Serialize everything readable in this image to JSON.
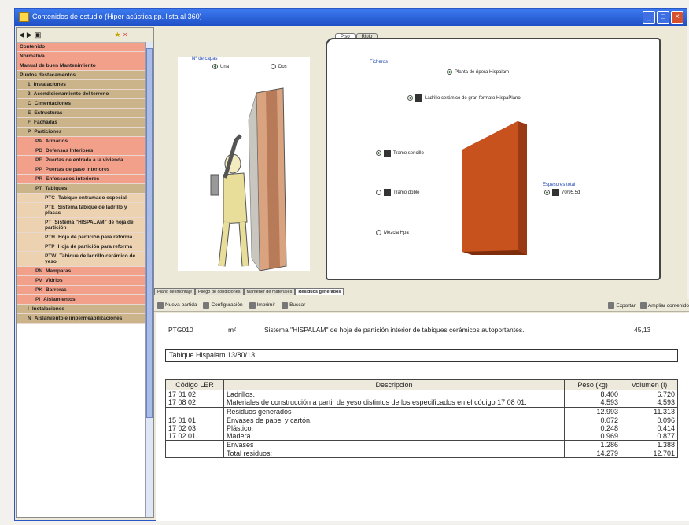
{
  "window": {
    "title": "Contenidos de estudio (Hiper acústica pp. lista al 360)",
    "buttons": [
      "_",
      "□",
      "×"
    ]
  },
  "sidebar": {
    "toolbar_icons": [
      "back-icon",
      "forward-icon",
      "car-icon",
      "star-icon",
      "close-icon"
    ],
    "items": [
      {
        "label": "Contenido",
        "color": "pink",
        "indent": 0
      },
      {
        "label": "Normativa",
        "color": "pink",
        "indent": 0
      },
      {
        "label": "Manual de buen Mantenimiento",
        "color": "pink",
        "indent": 0
      },
      {
        "label": "Puntos destacamentos",
        "color": "tan",
        "indent": 0
      },
      {
        "code": "1",
        "label": "Instalaciones",
        "color": "tan",
        "indent": 1
      },
      {
        "code": "2",
        "label": "Acondicionamiento del terreno",
        "color": "tan",
        "indent": 1
      },
      {
        "code": "C",
        "label": "Cimentaciones",
        "color": "tan",
        "indent": 1
      },
      {
        "code": "E",
        "label": "Estructuras",
        "color": "tan",
        "indent": 1
      },
      {
        "code": "F",
        "label": "Fachadas",
        "color": "tan",
        "indent": 1
      },
      {
        "code": "P",
        "label": "Particiones",
        "color": "tan",
        "indent": 1
      },
      {
        "code": "PA",
        "label": "Armarios",
        "color": "pink",
        "indent": 2
      },
      {
        "code": "PD",
        "label": "Defensas Interiores",
        "color": "pink",
        "indent": 2
      },
      {
        "code": "PE",
        "label": "Puertas de entrada a la vivienda",
        "color": "pink",
        "indent": 2
      },
      {
        "code": "PP",
        "label": "Puertas de paso interiores",
        "color": "pink",
        "indent": 2
      },
      {
        "code": "PR",
        "label": "Enfoscados interiores",
        "color": "pink",
        "indent": 2
      },
      {
        "code": "PT",
        "label": "Tabiques",
        "color": "tan",
        "indent": 2
      },
      {
        "code": "PTC",
        "label": "Tabique entramado especial",
        "color": "light",
        "indent": 3
      },
      {
        "code": "PTE",
        "label": "Sistema tabique de ladrillo y placas",
        "color": "light",
        "indent": 3
      },
      {
        "code": "PT",
        "label": "Sistema \"HISPALAM\" de hoja de partición",
        "color": "light",
        "indent": 3
      },
      {
        "code": "PTH",
        "label": "Hoja de partición para reforma",
        "color": "light",
        "indent": 3
      },
      {
        "code": "PTP",
        "label": "Hoja de partición para reforma",
        "color": "light",
        "indent": 3
      },
      {
        "code": "PTW",
        "label": "Tabique de ladrillo cerámico de yeso",
        "color": "light",
        "indent": 3
      },
      {
        "code": "PN",
        "label": "Mamparas",
        "color": "pink",
        "indent": 2
      },
      {
        "code": "PV",
        "label": "Vidrios",
        "color": "pink",
        "indent": 2
      },
      {
        "code": "PK",
        "label": "Barreras",
        "color": "pink",
        "indent": 2
      },
      {
        "code": "PI",
        "label": "Aislamientos",
        "color": "pink",
        "indent": 2
      },
      {
        "code": "I",
        "label": "Instalaciones",
        "color": "tan",
        "indent": 1
      },
      {
        "code": "N",
        "label": "Aislamiento e impermeabilizaciones",
        "color": "tan",
        "indent": 1
      }
    ]
  },
  "illustration": {
    "group_label": "Nº de capas",
    "radio_a": "Una",
    "radio_b": "Dos"
  },
  "tabs": {
    "items": [
      "Piso",
      "Ripio"
    ],
    "group_label": "Ficheros",
    "option_top": "Planta de ripera Hispalam",
    "option_select": "Ladrillo cerámico de gran formato HispaPlano",
    "left_options": [
      "Tramo sencillo",
      "Tramo doble",
      "Mezcla Hpa"
    ],
    "right_label": "Espesores total",
    "right_value": "70/95.5d"
  },
  "bottom_tabs": [
    "Plano desmontaje",
    "Pliego de condiciones",
    "Mantener de materiales",
    "Residuos generados"
  ],
  "toolbar": {
    "items": [
      "Nueva partida",
      "Configuración",
      "Imprimir",
      "Buscar"
    ],
    "right": [
      "Exportar",
      "Ampliar contenido"
    ]
  },
  "spec": {
    "code": "PTG010",
    "unit": "m²",
    "description": "Sistema \"HISPALAM\" de hoja de partición interior de tabiques cerámicos autoportantes.",
    "price": "45,13",
    "field_value": "Tabique Hispalam 13/80/13."
  },
  "table": {
    "headers": [
      "Código LER",
      "Descripción",
      "Peso (kg)",
      "Volumen (l)"
    ],
    "rows": [
      {
        "code": "17 01 02",
        "desc": "Ladrillos.",
        "peso": "8.400",
        "vol": "6.720",
        "type": "row"
      },
      {
        "code": "17 08 02",
        "desc": "Materiales de construcción a partir de yeso distintos de los especificados en el código 17 08 01.",
        "peso": "4.593",
        "vol": "4.593",
        "type": "row"
      },
      {
        "code": "",
        "desc": "Residuos generados",
        "peso": "12.993",
        "vol": "11.313",
        "type": "sub"
      },
      {
        "code": "15 01 01",
        "desc": "Envases de papel y cartón.",
        "peso": "0.072",
        "vol": "0.096",
        "type": "row"
      },
      {
        "code": "17 02 03",
        "desc": "Plástico.",
        "peso": "0.248",
        "vol": "0.414",
        "type": "row"
      },
      {
        "code": "17 02 01",
        "desc": "Madera.",
        "peso": "0.969",
        "vol": "0.877",
        "type": "row"
      },
      {
        "code": "",
        "desc": "Envases",
        "peso": "1.286",
        "vol": "1.388",
        "type": "sub"
      },
      {
        "code": "",
        "desc": "Total residuos:",
        "peso": "14.279",
        "vol": "12.701",
        "type": "tot"
      }
    ]
  },
  "colors": {
    "accent": "#2a56c6",
    "wall": "#c8521e",
    "sidebar_pink": "#f2a08a",
    "sidebar_tan": "#cbb48a"
  }
}
